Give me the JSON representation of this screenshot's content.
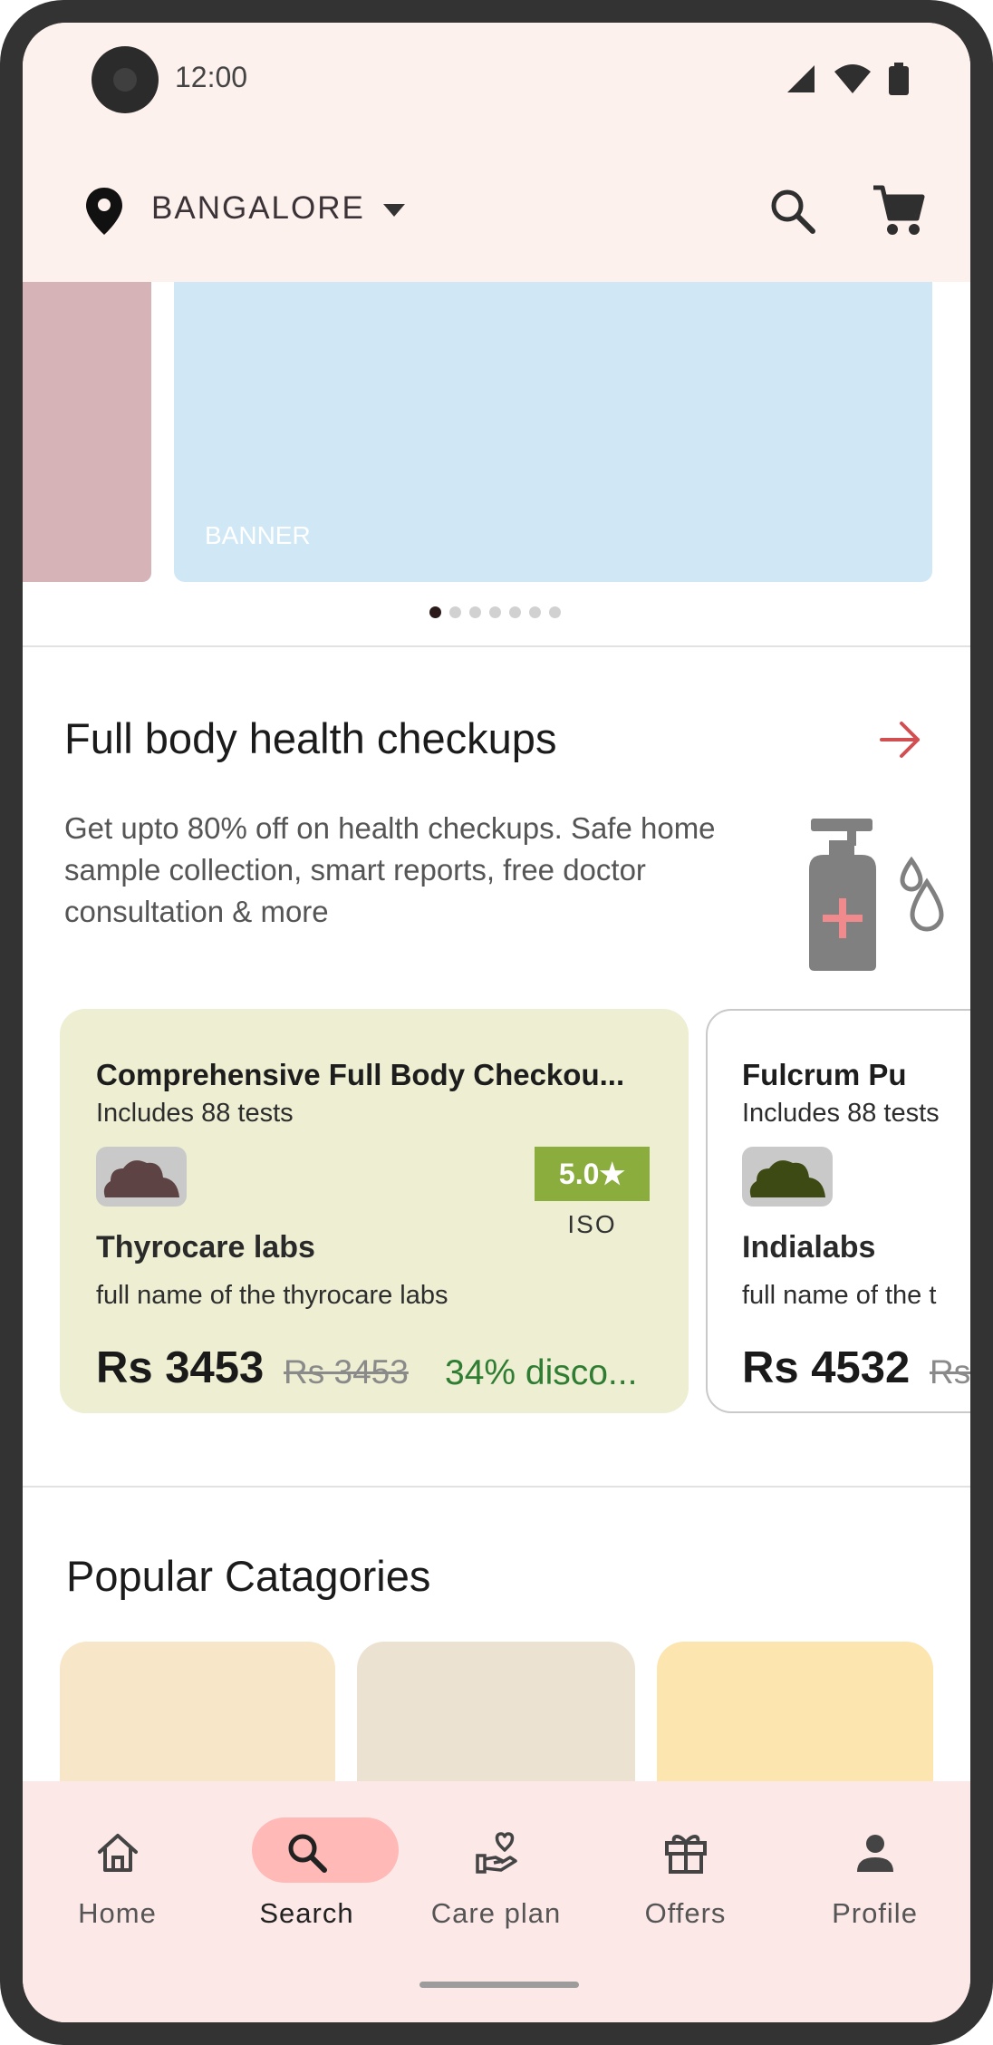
{
  "status_bar": {
    "time": "12:00"
  },
  "header": {
    "city": "BANGALORE"
  },
  "banner": {
    "label": "BANNER",
    "page_count": 7,
    "active_index": 0
  },
  "health_section": {
    "title": "Full body health checkups",
    "description": "Get upto 80% off on health checkups. Safe home sample collection, smart reports, free doctor consultation & more"
  },
  "checkup_cards": [
    {
      "title": "Comprehensive Full Body Checkou...",
      "tests": "Includes 88 tests",
      "rating": "5.0★",
      "certification": "ISO",
      "lab_name": "Thyrocare labs",
      "lab_full_name": "full name of the thyrocare labs",
      "price": "Rs 3453",
      "old_price": "Rs 3453",
      "discount": "34% disco...",
      "logo_color": "#5e4345"
    },
    {
      "title": "Fulcrum Pu",
      "tests": "Includes 88 tests",
      "lab_name": "Indialabs",
      "lab_full_name": "full name of the t",
      "price": "Rs 4532",
      "old_price": "Rs",
      "logo_color": "#3d4a14"
    }
  ],
  "categories_section": {
    "title": "Popular Catagories",
    "tile_colors": [
      "#f8e6c8",
      "#ece2d2",
      "#fde5b0"
    ]
  },
  "bottom_nav": {
    "items": [
      {
        "label": "Home",
        "icon": "home-icon"
      },
      {
        "label": "Search",
        "icon": "search-icon",
        "active": true
      },
      {
        "label": "Care plan",
        "icon": "care-plan-icon"
      },
      {
        "label": "Offers",
        "icon": "gift-icon"
      },
      {
        "label": "Profile",
        "icon": "person-icon"
      }
    ]
  },
  "colors": {
    "accent": "#d14f53",
    "discount_green": "#2e7d32",
    "rating_badge": "#8aad3d",
    "active_nav_pill": "#ffb9b6"
  }
}
